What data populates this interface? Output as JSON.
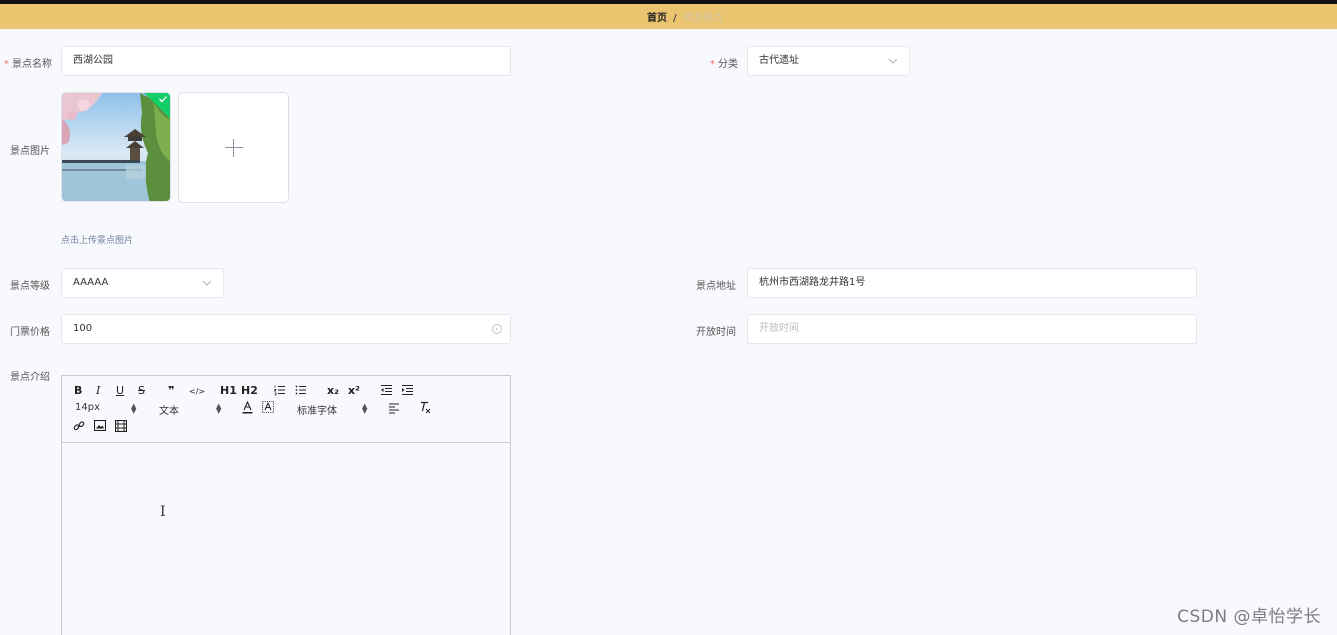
{
  "breadcrumb": {
    "home": "首页",
    "separator": "/",
    "current": "旅游景点"
  },
  "form": {
    "name": {
      "label": "景点名称",
      "value": "西湖公园",
      "required": true
    },
    "category": {
      "label": "分类",
      "value": "古代遗址",
      "required": true
    },
    "image": {
      "label": "景点图片",
      "hint": "点击上传景点图片"
    },
    "level": {
      "label": "景点等级",
      "value": "AAAAA"
    },
    "address": {
      "label": "景点地址",
      "value": "杭州市西湖路龙井路1号"
    },
    "price": {
      "label": "门票价格",
      "value": "100"
    },
    "open_time": {
      "label": "开放时间",
      "placeholder": "开放时间"
    },
    "intro": {
      "label": "景点介绍"
    }
  },
  "editor": {
    "font_size": "14px",
    "header_select": "文本",
    "font_family": "标准字体",
    "buttons": [
      "B",
      "I",
      "U",
      "S",
      "❞",
      "</>",
      "H1",
      "H2",
      "ordered-list",
      "bullet-list",
      "x₂",
      "x²",
      "outdent",
      "indent",
      "text-color",
      "background-color",
      "align",
      "clear-format",
      "link",
      "image",
      "video"
    ]
  },
  "colors": {
    "topbar": "#ebc46f",
    "required": "#f56c6c",
    "success_badge": "#13ce66"
  },
  "watermark": "CSDN @卓怡学长"
}
